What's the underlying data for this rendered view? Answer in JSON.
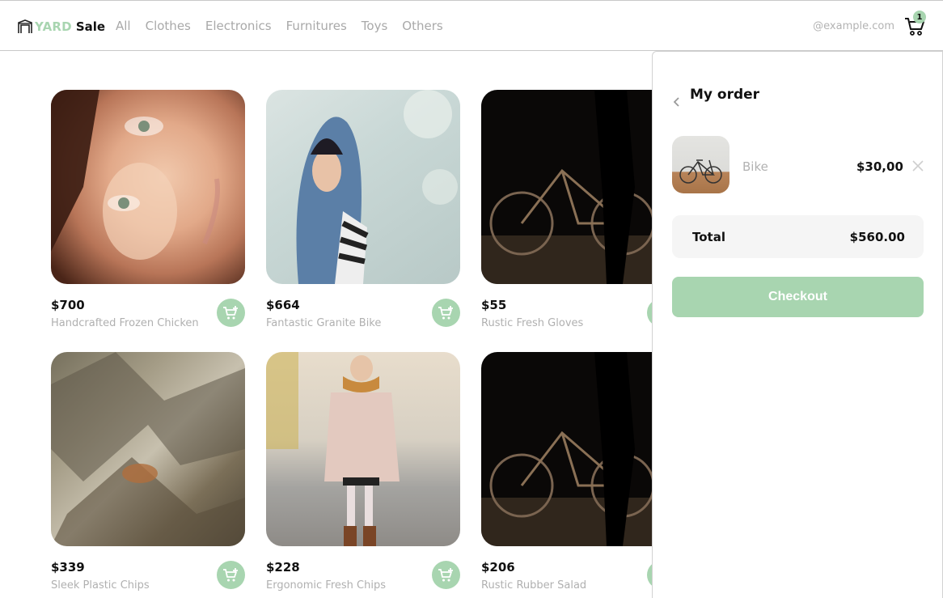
{
  "brand": {
    "word1": "YARD",
    "word2": "Sale",
    "accent": "#a8d5b0"
  },
  "nav": {
    "links": [
      "All",
      "Clothes",
      "Electronics",
      "Furnitures",
      "Toys",
      "Others"
    ],
    "email": "@example.com",
    "cart_count": "1",
    "cart_icon": "cart-icon"
  },
  "products": [
    {
      "price": "$700",
      "title": "Handcrafted Frozen Chicken"
    },
    {
      "price": "$664",
      "title": "Fantastic Granite Bike"
    },
    {
      "price": "$55",
      "title": "Rustic Fresh Gloves"
    },
    {
      "price": "$339",
      "title": "Sleek Plastic Chips"
    },
    {
      "price": "$228",
      "title": "Ergonomic Fresh Chips"
    },
    {
      "price": "$206",
      "title": "Rustic Rubber Salad"
    }
  ],
  "order": {
    "title": "My order",
    "items": [
      {
        "name": "Bike",
        "price": "$30,00"
      }
    ],
    "total_label": "Total",
    "total_value": "$560.00",
    "checkout_label": "Checkout"
  }
}
